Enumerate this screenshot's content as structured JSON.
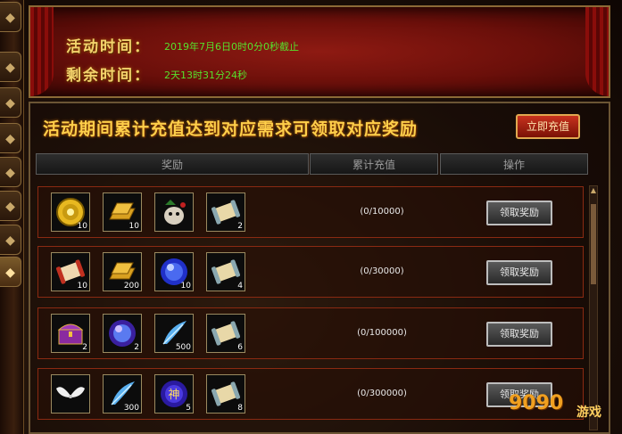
{
  "left_tabs": [
    {
      "glyph": "◆",
      "active": false
    },
    {
      "glyph": "◆",
      "active": false
    },
    {
      "glyph": "◆",
      "active": false
    },
    {
      "glyph": "◆",
      "active": false
    },
    {
      "glyph": "◆",
      "active": false
    },
    {
      "glyph": "◆",
      "active": false
    },
    {
      "glyph": "◆",
      "active": false
    },
    {
      "glyph": "◆",
      "active": true
    }
  ],
  "banner": {
    "time_label": "活动时间：",
    "time_value": "2019年7月6日0时0分0秒截止",
    "remain_label": "剩余时间：",
    "remain_value": "2天13时31分24秒"
  },
  "panel": {
    "headline": "活动期间累计充值达到对应需求可领取对应奖励",
    "recharge_button": "立即充值",
    "columns": {
      "reward": "奖励",
      "total": "累计充值",
      "action": "操作"
    }
  },
  "rows": [
    {
      "progress": "(0/10000)",
      "claim_label": "领取奖励",
      "items": [
        {
          "icon": "gold-coin-icon",
          "qty": "10"
        },
        {
          "icon": "gold-bar-icon",
          "qty": "10"
        },
        {
          "icon": "pet-creature-icon",
          "qty": ""
        },
        {
          "icon": "scroll-icon",
          "qty": "2"
        }
      ]
    },
    {
      "progress": "(0/30000)",
      "claim_label": "领取奖励",
      "items": [
        {
          "icon": "red-scroll-icon",
          "qty": "10"
        },
        {
          "icon": "gold-bar-icon",
          "qty": "200"
        },
        {
          "icon": "blue-orb-icon",
          "qty": "10"
        },
        {
          "icon": "scroll-icon",
          "qty": "4"
        }
      ]
    },
    {
      "progress": "(0/100000)",
      "claim_label": "领取奖励",
      "items": [
        {
          "icon": "treasure-chest-icon",
          "qty": "2"
        },
        {
          "icon": "purple-orb-icon",
          "qty": "2"
        },
        {
          "icon": "blue-feather-icon",
          "qty": "500"
        },
        {
          "icon": "scroll-icon",
          "qty": "6"
        }
      ]
    },
    {
      "progress": "(0/300000)",
      "claim_label": "领取奖励",
      "items": [
        {
          "icon": "white-wings-icon",
          "qty": ""
        },
        {
          "icon": "blue-feather-icon",
          "qty": "300"
        },
        {
          "icon": "divine-orb-icon",
          "qty": "5",
          "glyph": "神"
        },
        {
          "icon": "scroll-icon",
          "qty": "8"
        }
      ]
    }
  ],
  "watermark": {
    "text": "9090",
    "suffix": "游戏"
  }
}
